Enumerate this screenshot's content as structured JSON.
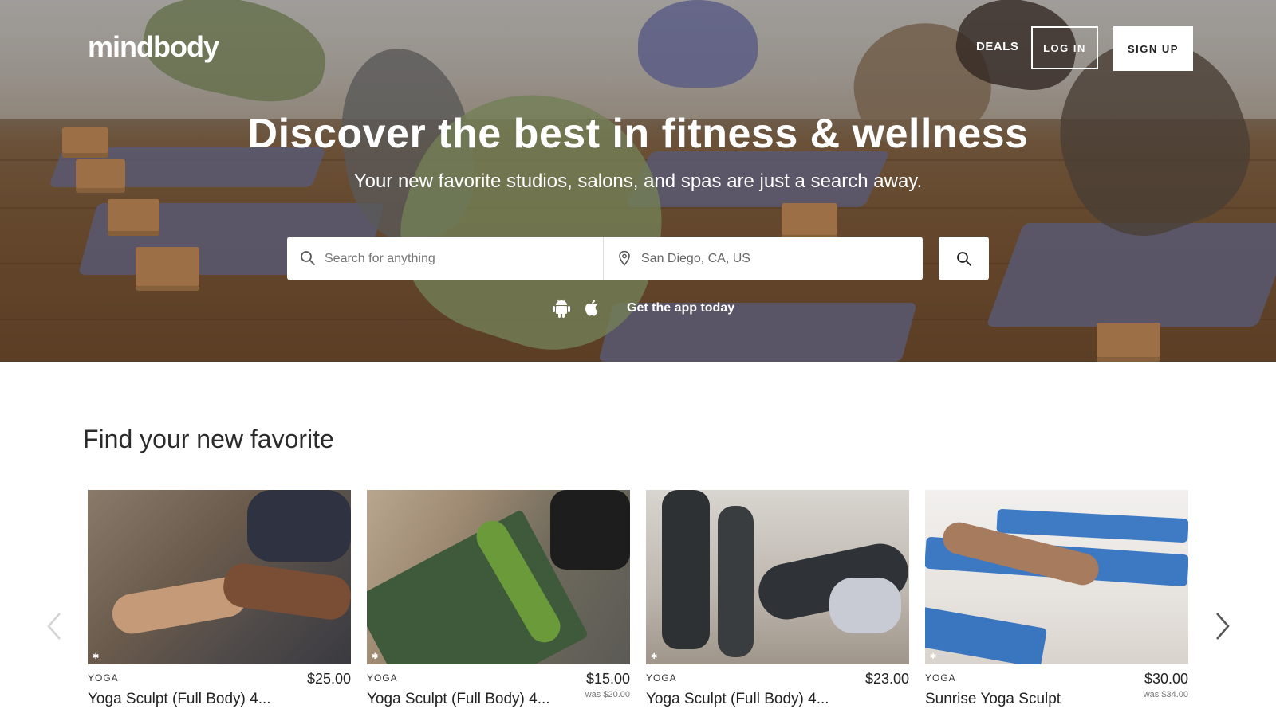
{
  "brand": {
    "logo": "mindbody"
  },
  "nav": {
    "deals": "DEALS",
    "login": "LOG IN",
    "signup": "SIGN UP"
  },
  "hero": {
    "title": "Discover the best in fitness & wellness",
    "subtitle": "Your new favorite studios, salons, and spas are just a search away."
  },
  "search": {
    "what_placeholder": "Search for anything",
    "where_value": "San Diego, CA, US"
  },
  "app": {
    "text": "Get the app today",
    "icons": [
      "android-icon",
      "apple-icon"
    ]
  },
  "section": {
    "title": "Find your new favorite"
  },
  "cards": [
    {
      "category": "YOGA",
      "name": "Yoga Sculpt (Full Body) 4...",
      "price": "$25.00",
      "was": ""
    },
    {
      "category": "YOGA",
      "name": "Yoga Sculpt (Full Body) 4...",
      "price": "$15.00",
      "was": "was $20.00"
    },
    {
      "category": "YOGA",
      "name": "Yoga Sculpt (Full Body) 4...",
      "price": "$23.00",
      "was": ""
    },
    {
      "category": "YOGA",
      "name": "Sunrise Yoga Sculpt",
      "price": "$30.00",
      "was": "was $34.00"
    }
  ],
  "colors": {
    "hero_overlay": "#000000",
    "text_dark": "#222222",
    "white": "#ffffff"
  }
}
